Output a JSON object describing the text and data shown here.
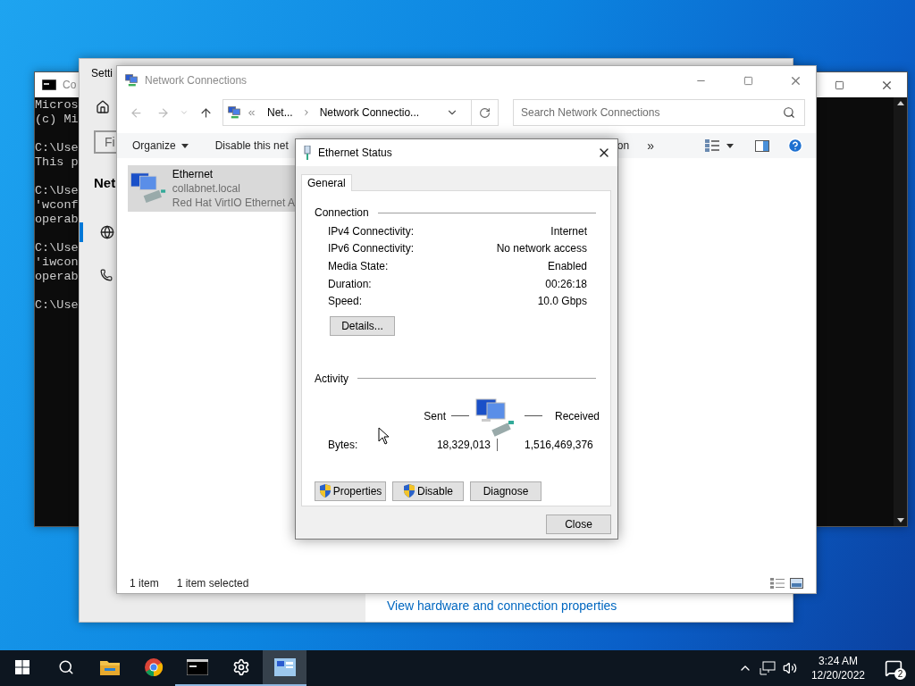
{
  "cmd_window": {
    "title": "Co",
    "paragraphs": [
      [
        "Micros",
        "(c) Mi"
      ],
      [
        "C:\\Use",
        "This p"
      ],
      [
        "C:\\Use",
        "'wconf",
        "operab"
      ],
      [
        "C:\\Use",
        "'iwcon",
        "operab"
      ],
      [
        "C:\\Use"
      ]
    ]
  },
  "settings_window": {
    "title": "Setti",
    "search": {
      "placeholder": "Fi"
    },
    "heading": "Net",
    "nav": [
      {
        "kind": "globe",
        "selected": true
      },
      {
        "kind": "dialup",
        "selected": false
      }
    ],
    "link": "View hardware and connection properties"
  },
  "network_window": {
    "title": "Network Connections",
    "breadcrumbs": [
      "Net...",
      "Network Connectio..."
    ],
    "search": {
      "placeholder": "Search Network Connections"
    },
    "toolbar": [
      {
        "label": "Organize",
        "kind": "menu"
      },
      {
        "label": "Disable this net",
        "kind": "plain"
      },
      {
        "label": "on",
        "kind": "plain"
      },
      {
        "label": "»",
        "kind": "more"
      }
    ],
    "items": [
      {
        "name": "Ethernet",
        "domain": "collabnet.local",
        "adapter": "Red Hat VirtIO Ethernet A",
        "selected": true
      }
    ],
    "status": [
      "1 item",
      "1 item selected"
    ]
  },
  "dialog": {
    "title": "Ethernet Status",
    "tabs": [
      {
        "label": "General",
        "selected": true
      }
    ],
    "connection": {
      "label": "Connection",
      "rows": [
        {
          "label": "IPv4 Connectivity:",
          "value": "Internet"
        },
        {
          "label": "IPv6 Connectivity:",
          "value": "No network access"
        },
        {
          "label": "Media State:",
          "value": "Enabled"
        },
        {
          "label": "Duration:",
          "value": "00:26:18"
        },
        {
          "label": "Speed:",
          "value": "10.0 Gbps"
        }
      ],
      "details_button": "Details..."
    },
    "activity": {
      "label": "Activity",
      "sent": "Sent",
      "received": "Received",
      "bytes_label": "Bytes:",
      "bytes_sent": "18,329,013",
      "bytes_received": "1,516,469,376"
    },
    "buttons": [
      {
        "label": "Properties",
        "shield": true
      },
      {
        "label": "Disable",
        "shield": true
      },
      {
        "label": "Diagnose",
        "shield": false
      }
    ],
    "close_button": "Close"
  },
  "taskbar": {
    "items": [
      {
        "kind": "start",
        "open": false,
        "selected": false
      },
      {
        "kind": "search",
        "open": false,
        "selected": false
      },
      {
        "kind": "explorer",
        "open": false,
        "selected": false
      },
      {
        "kind": "chrome",
        "open": false,
        "selected": false
      },
      {
        "kind": "terminal",
        "open": true,
        "selected": false
      },
      {
        "kind": "settings",
        "open": true,
        "selected": false
      },
      {
        "kind": "network",
        "open": true,
        "selected": true
      }
    ],
    "time": "3:24 AM",
    "date": "12/20/2022",
    "notifications": "2"
  }
}
